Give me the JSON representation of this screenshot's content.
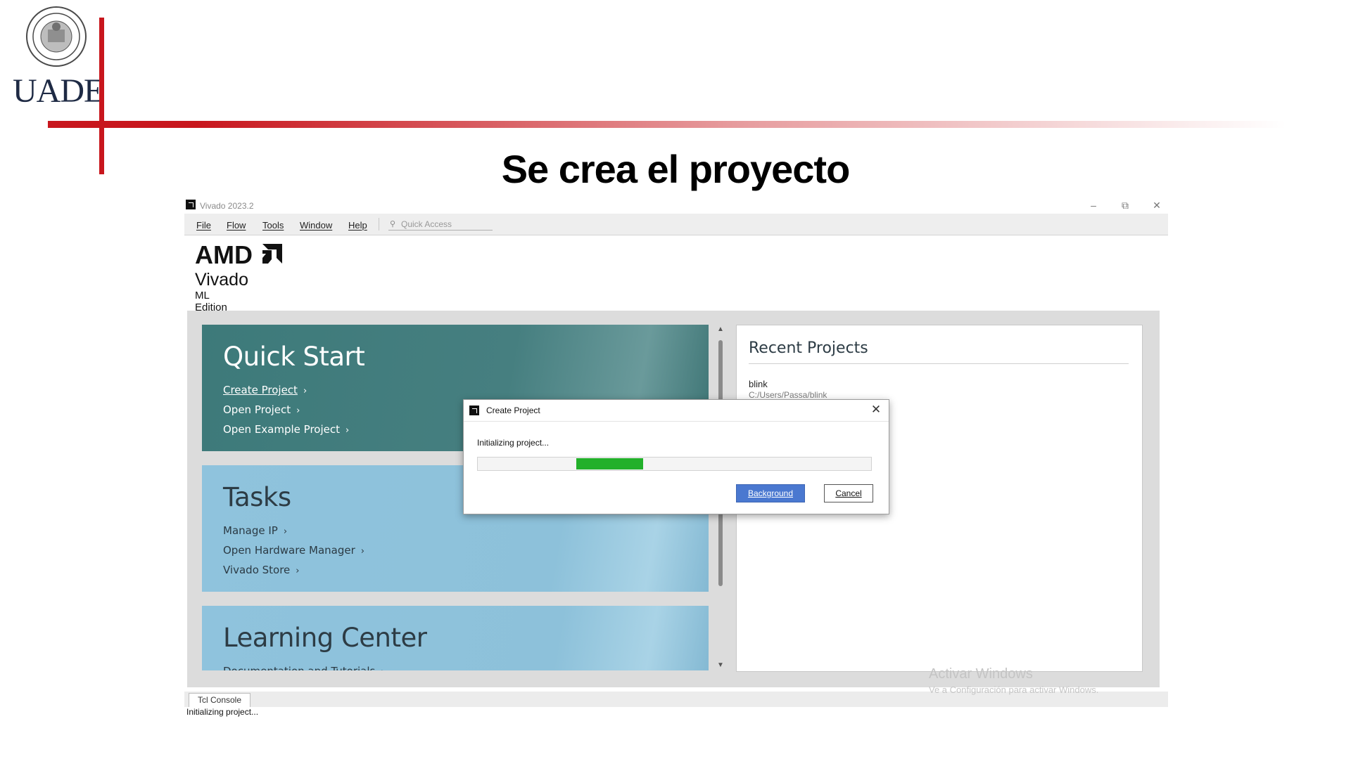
{
  "slide": {
    "logo_text": "UADE",
    "title": "Se crea el proyecto"
  },
  "window": {
    "title": "Vivado 2023.2",
    "controls": [
      "minimize-icon",
      "restore-icon",
      "close-icon"
    ]
  },
  "menu": {
    "items": [
      "File",
      "Flow",
      "Tools",
      "Window",
      "Help"
    ],
    "quick_access_placeholder": "Quick Access"
  },
  "brand": {
    "company": "AMD",
    "product": "Vivado",
    "edition": "ML Edition"
  },
  "quick_start": {
    "title": "Quick Start",
    "links": [
      "Create Project",
      "Open Project",
      "Open Example Project"
    ]
  },
  "tasks": {
    "title": "Tasks",
    "links": [
      "Manage IP",
      "Open Hardware Manager",
      "Vivado Store"
    ]
  },
  "learning_center": {
    "title": "Learning Center",
    "links": [
      "Documentation and Tutorials"
    ]
  },
  "recent_projects": {
    "title": "Recent Projects",
    "items": [
      {
        "name": "blink",
        "path": "C:/Users/Passa/blink"
      }
    ]
  },
  "bottom": {
    "tab": "Tcl Console",
    "status": "Initializing project..."
  },
  "dialog": {
    "title": "Create Project",
    "message": "Initializing project...",
    "progress": {
      "start": 0.25,
      "end": 0.42
    },
    "background_button": "Background",
    "cancel_button": "Cancel"
  },
  "watermark": {
    "title": "Activar Windows",
    "subtitle": "Ve a Configuración para activar Windows."
  },
  "colors": {
    "accent_red": "#c8161d",
    "quick_start_bg": "#3d7a7a",
    "tasks_bg": "#8fc3dd",
    "progress_green": "#22b02a",
    "primary_button": "#4a78d0"
  }
}
